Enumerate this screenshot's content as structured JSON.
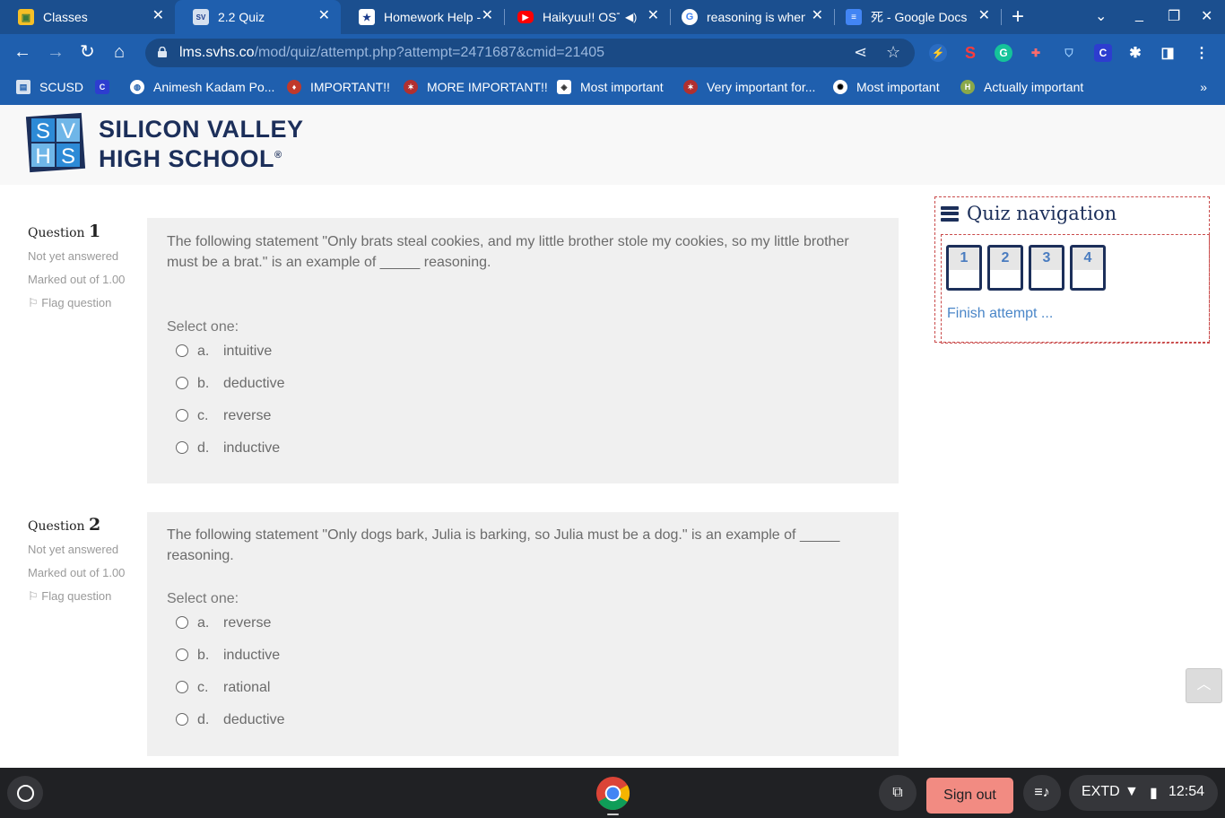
{
  "browser": {
    "tabs": [
      {
        "title": "Classes",
        "icon": "classes-icon",
        "color": "#f6bf26"
      },
      {
        "title": "2.2 Quiz",
        "icon": "svhs-icon",
        "color": "#9bb6db"
      },
      {
        "title": "Homework Help - ",
        "icon": "star-icon",
        "color": "#1c3c8c"
      },
      {
        "title": "Haikyuu!! OST",
        "icon": "youtube-icon",
        "color": "#ff0000"
      },
      {
        "title": "reasoning is when",
        "icon": "google-icon",
        "color": "#ffffff"
      },
      {
        "title": "死 - Google Docs",
        "icon": "docs-icon",
        "color": "#4285f4"
      }
    ],
    "url_host": "lms.svhs.co",
    "url_path": "/mod/quiz/attempt.php?attempt=2471687&cmid=21405",
    "bookmarks": [
      {
        "label": "SCUSD",
        "icon": "folder-icon"
      },
      {
        "label": "",
        "icon": "c-icon"
      },
      {
        "label": "Animesh Kadam Po...",
        "icon": "globe-icon"
      },
      {
        "label": "IMPORTANT!!",
        "icon": "mask-icon"
      },
      {
        "label": "MORE IMPORTANT!!",
        "icon": "emblem-icon"
      },
      {
        "label": "Most important",
        "icon": "seal-icon"
      },
      {
        "label": "Very important for...",
        "icon": "emblem-icon"
      },
      {
        "label": "Most important",
        "icon": "logo-icon"
      },
      {
        "label": "Actually important",
        "icon": "badge-icon"
      }
    ],
    "bookmarks_more": "»"
  },
  "site": {
    "logo_line1": "SILICON VALLEY",
    "logo_line2": "HIGH SCHOOL",
    "logo_mark": [
      "S",
      "V",
      "H",
      "S"
    ],
    "logo_reg": "®"
  },
  "questions": [
    {
      "label": "Question",
      "number": "1",
      "status": "Not yet answered",
      "marked": "Marked out of 1.00",
      "flag": "Flag question",
      "text": "The following statement \"Only brats steal cookies, and my little brother stole my cookies, so my little brother must be a brat.\"  is an example of _____ reasoning.",
      "select": "Select one:",
      "options": [
        {
          "letter": "a.",
          "text": "intuitive"
        },
        {
          "letter": "b.",
          "text": "deductive"
        },
        {
          "letter": "c.",
          "text": "reverse"
        },
        {
          "letter": "d.",
          "text": "inductive"
        }
      ]
    },
    {
      "label": "Question",
      "number": "2",
      "status": "Not yet answered",
      "marked": "Marked out of 1.00",
      "flag": "Flag question",
      "text": "The following statement \"Only dogs bark, Julia is barking, so Julia must be a dog.\"  is an example of _____ reasoning.",
      "select": "Select one:",
      "options": [
        {
          "letter": "a.",
          "text": "reverse"
        },
        {
          "letter": "b.",
          "text": "inductive"
        },
        {
          "letter": "c.",
          "text": "rational"
        },
        {
          "letter": "d.",
          "text": "deductive"
        }
      ]
    }
  ],
  "quiz_nav": {
    "title": "Quiz navigation",
    "buttons": [
      "1",
      "2",
      "3",
      "4"
    ],
    "finish": "Finish attempt ..."
  },
  "shelf": {
    "sign_out": "Sign out",
    "tray_label": "EXTD",
    "time": "12:54"
  }
}
